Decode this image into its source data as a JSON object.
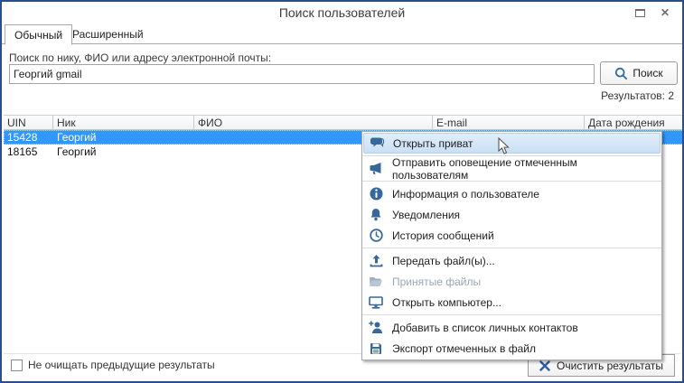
{
  "window": {
    "title": "Поиск пользователей",
    "controls": {
      "maximize": "maximize",
      "close": "close"
    }
  },
  "tabs": [
    {
      "label": "Обычный",
      "active": true
    },
    {
      "label": "Расширенный",
      "active": false
    }
  ],
  "search": {
    "label": "Поиск по нику, ФИО или адресу электронной почты:",
    "value": "Георгий gmail",
    "button_label": "Поиск",
    "button_icon": "magnifier-icon",
    "results_label": "Результатов: 2"
  },
  "table": {
    "columns": [
      "UIN",
      "Ник",
      "ФИО",
      "E-mail",
      "Дата рождения"
    ],
    "rows": [
      {
        "uin": "15428",
        "nick": "Георгий",
        "fio": "",
        "email": "",
        "birth": "",
        "selected": true
      },
      {
        "uin": "18165",
        "nick": "Георгий",
        "fio": "",
        "email": "",
        "birth": "",
        "selected": false
      }
    ]
  },
  "context_menu": {
    "items": [
      {
        "label": "Открыть приват",
        "icon": "chat-icon",
        "state": "hover"
      },
      {
        "label": "Отправить оповещение отмеченным пользователям",
        "icon": "megaphone-icon",
        "state": "normal"
      },
      {
        "label": "Информация о пользователе",
        "icon": "info-icon",
        "state": "normal"
      },
      {
        "label": "Уведомления",
        "icon": "bell-icon",
        "state": "normal"
      },
      {
        "label": "История сообщений",
        "icon": "clock-icon",
        "state": "normal"
      },
      {
        "label": "Передать файл(ы)...",
        "icon": "upload-icon",
        "state": "normal"
      },
      {
        "label": "Принятые файлы",
        "icon": "folder-open-icon",
        "state": "disabled"
      },
      {
        "label": "Открыть компьютер...",
        "icon": "computer-icon",
        "state": "normal"
      },
      {
        "label": "Добавить в список личных контактов",
        "icon": "person-add-icon",
        "state": "normal"
      },
      {
        "label": "Экспорт отмеченных в файл",
        "icon": "save-icon",
        "state": "normal"
      }
    ]
  },
  "footer": {
    "checkbox_label": "Не очищать предыдущие результаты",
    "checkbox_checked": false,
    "clear_button_label": "Очистить результаты",
    "clear_button_icon": "x-icon"
  },
  "colors": {
    "window_border": "#2a4d8d",
    "selected_row": "#3297fd",
    "menu_icon": "#36689b",
    "menu_hover_bg": "#cfe2f6",
    "disabled_text": "#9aa5b5",
    "accent_blue": "#2e5fa3"
  }
}
